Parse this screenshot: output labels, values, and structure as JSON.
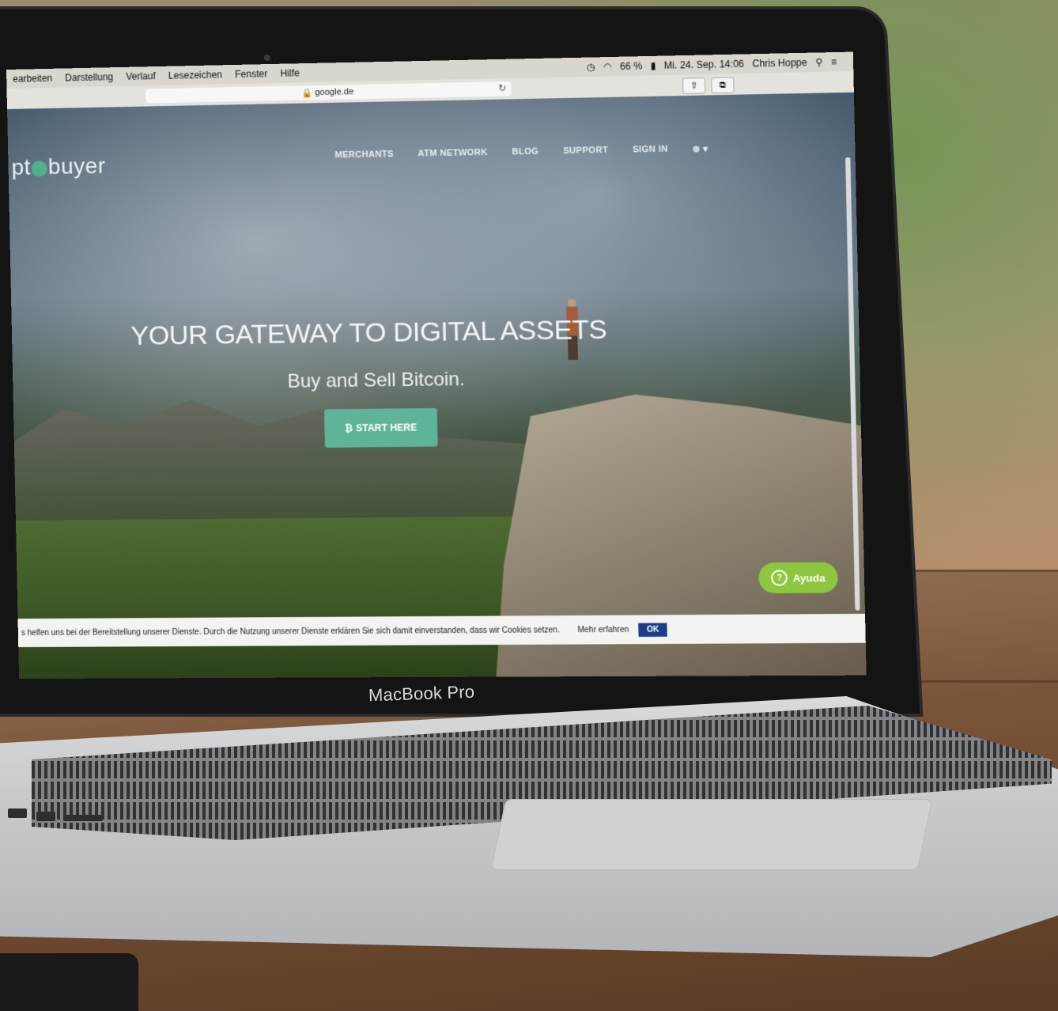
{
  "menubar": {
    "items": [
      "earbeiten",
      "Darstellung",
      "Verlauf",
      "Lesezeichen",
      "Fenster",
      "Hilfe"
    ],
    "battery": "66 %",
    "datetime": "Mi. 24. Sep. 14:06",
    "user": "Chris Hoppe"
  },
  "browser": {
    "url": "google.de"
  },
  "site": {
    "logo_left": "pt",
    "logo_right": "buyer",
    "nav": [
      "MERCHANTS",
      "ATM NETWORK",
      "BLOG",
      "SUPPORT",
      "SIGN IN"
    ],
    "language_icon": "globe-icon",
    "headline": "YOUR GATEWAY TO DIGITAL ASSETS",
    "subheadline": "Buy and Sell Bitcoin.",
    "cta_label": "START HERE",
    "help_label": "Ayuda",
    "help_color": "#8dc63f",
    "cta_color": "#5fb39a"
  },
  "cookie_bar": {
    "text": "s helfen uns bei der Bereitstellung unserer Dienste. Durch die Nutzung unserer Dienste erklären Sie sich damit einverstanden, dass wir Cookies setzen.",
    "more_label": "Mehr erfahren",
    "ok_label": "OK"
  },
  "laptop": {
    "brand": "MacBook Pro"
  }
}
